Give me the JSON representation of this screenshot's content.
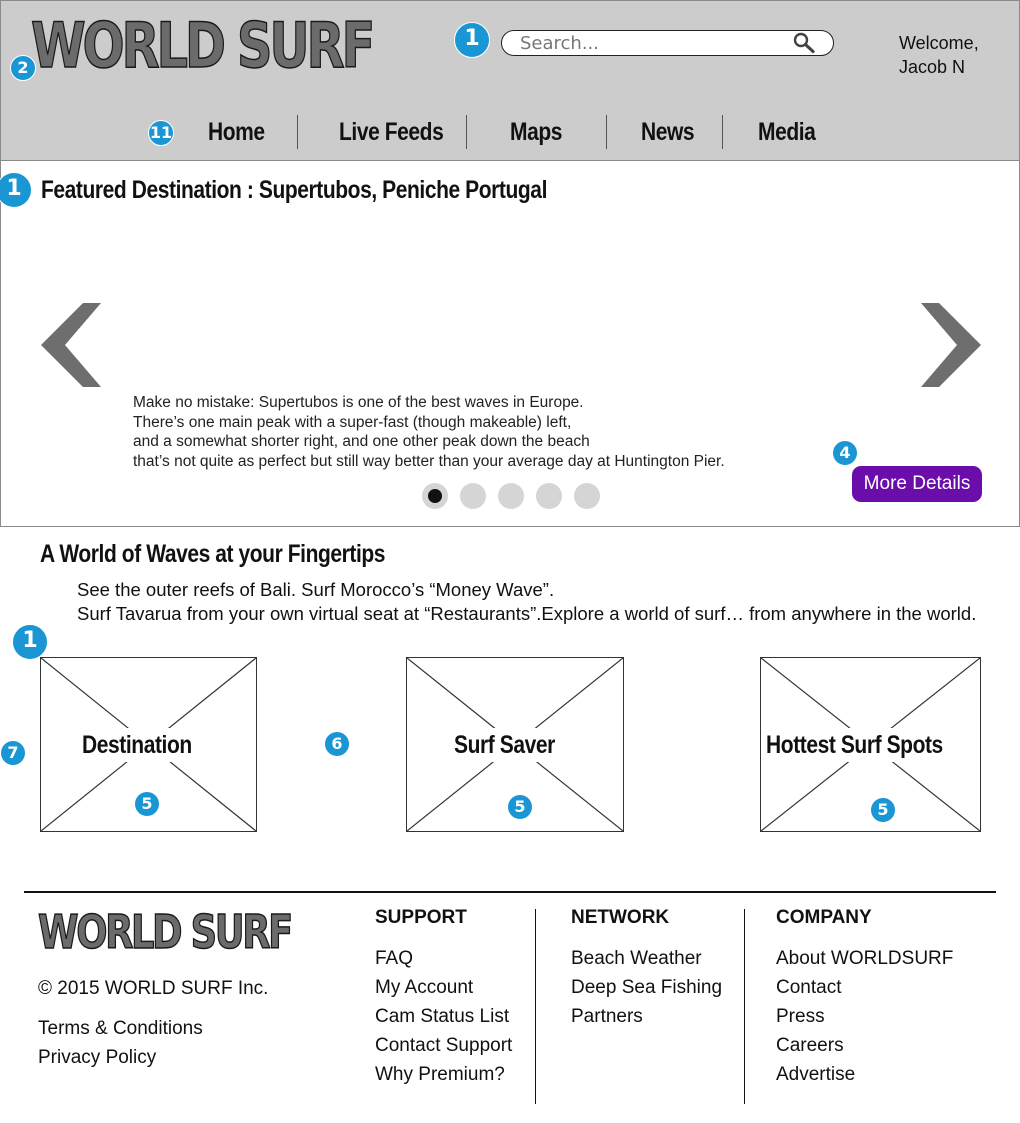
{
  "header": {
    "logo": "WORLD SURF",
    "search_placeholder": "Search...",
    "search_icon": "search-icon",
    "welcome_line1": "Welcome,",
    "welcome_line2": "Jacob N"
  },
  "nav": {
    "items": [
      {
        "label": "Home"
      },
      {
        "label": "Live Feeds"
      },
      {
        "label": "Maps"
      },
      {
        "label": "News"
      },
      {
        "label": "Media"
      }
    ]
  },
  "markers": {
    "m_search": "1",
    "m_logo": "2",
    "m_nav": "11",
    "m_featured": "1",
    "m_details": "4",
    "m_section": "1",
    "m_left": "7",
    "m_mid": "6",
    "m_card1": "5",
    "m_card2": "5",
    "m_card3": "5"
  },
  "featured": {
    "title": "Featured Destination : Supertubos, Peniche Portugal",
    "desc_lines": [
      "Make no mistake: Supertubos is one of the best waves in Europe.",
      "There’s one main peak with a super-fast (though makeable) left,",
      "and a somewhat shorter right, and one other peak down the beach",
      "that’s not quite as perfect but still way better than your average day at Huntington Pier."
    ],
    "slides_total": 5,
    "active_slide": 1,
    "more_button": "More Details",
    "button_color": "#6a0dab"
  },
  "waves": {
    "title": "A World of Waves at your Fingertips",
    "line1": "See the outer reefs of Bali. Surf Morocco’s “Money Wave”.",
    "line2": "Surf Tavarua from your own virtual seat at “Restaurants”.Explore a world of surf… from anywhere in the world.",
    "cards": [
      {
        "label": "Destination"
      },
      {
        "label": "Surf Saver"
      },
      {
        "label": "Hottest Surf Spots"
      }
    ]
  },
  "footer": {
    "logo": "WORLD SURF",
    "copyright": "© 2015 WORLD SURF Inc.",
    "terms": "Terms & Conditions",
    "privacy": "Privacy Policy",
    "support": {
      "heading": "SUPPORT",
      "links": [
        "FAQ",
        "My Account",
        "Cam Status List",
        "Contact Support",
        "Why Premium?"
      ]
    },
    "network": {
      "heading": "NETWORK",
      "links": [
        "Beach Weather",
        "Deep Sea Fishing",
        "Partners"
      ]
    },
    "company": {
      "heading": "COMPANY",
      "links": [
        "About WORLDSURF",
        "Contact",
        "Press",
        "Careers",
        "Advertise"
      ]
    }
  },
  "colors": {
    "header_bg": "#cccccc",
    "marker": "#1a96d4",
    "accent": "#6a0dab"
  }
}
